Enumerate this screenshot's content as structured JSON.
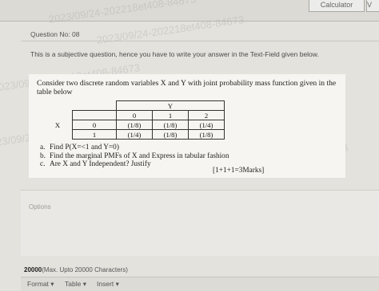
{
  "header": {
    "calculator_label": "Calculator",
    "second_button_label": "V"
  },
  "question": {
    "number_label": "Question No: 08",
    "instruction": "This is a subjective question, hence you have to write your answer in the Text-Field given below."
  },
  "problem": {
    "statement": "Consider two discrete random variables X and Y with joint probability mass function given in the table below",
    "table": {
      "col_var": "Y",
      "row_var": "X",
      "col_headers": [
        "0",
        "1",
        "2"
      ],
      "rows": [
        {
          "x": "0",
          "cells": [
            "(1/8)",
            "(1/8)",
            "(1/4)"
          ]
        },
        {
          "x": "1",
          "cells": [
            "(1/4)",
            "(1/8)",
            "(1/8)"
          ]
        }
      ]
    },
    "parts": [
      {
        "label": "a.",
        "text": "Find P(X=<1 and Y=0)"
      },
      {
        "label": "b.",
        "text": "Find the marginal PMFs of X and Express in tabular fashion"
      },
      {
        "label": "c.",
        "text": "Are X and Y Independent? Justify"
      }
    ],
    "marks": "[1+1+1=3Marks]"
  },
  "answer": {
    "options_label": "Options",
    "char_limit_value": "20000",
    "char_limit_text": "(Max. Upto 20000 Characters)"
  },
  "toolbar": {
    "format_label": "Format",
    "table_label": "Table",
    "insert_label": "Insert"
  },
  "watermark_text": "2023/09/24-202218et408-84673"
}
